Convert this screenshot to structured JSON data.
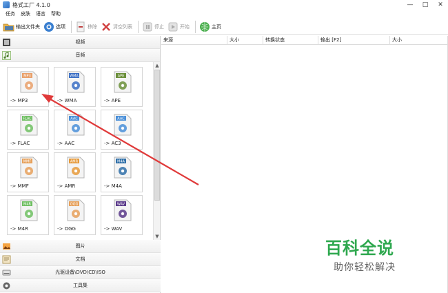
{
  "window": {
    "title": "格式工厂 4.1.0",
    "controls": [
      "—",
      "□",
      "✕"
    ]
  },
  "menu": [
    "任务",
    "皮肤",
    "语言",
    "帮助"
  ],
  "toolbar": {
    "output_folder": "输出文件夹",
    "options": "选项",
    "remove": "移除",
    "clear_list": "清空列表",
    "stop": "停止",
    "start": "开始",
    "home": "主页"
  },
  "categories": {
    "video": "视频",
    "audio": "音频",
    "picture": "图片",
    "document": "文档",
    "disc": "光驱设备\\DVD\\CD\\ISO",
    "tools": "工具集"
  },
  "audio_formats": [
    {
      "badge": "MP3",
      "label": "-> MP3",
      "color": "#e9a06a"
    },
    {
      "badge": "WMA",
      "label": "-> WMA",
      "color": "#3a6ec4"
    },
    {
      "badge": "APE",
      "label": "-> APE",
      "color": "#6b8f3a"
    },
    {
      "badge": "FLAC",
      "label": "-> FLAC",
      "color": "#6fbf62"
    },
    {
      "badge": "AAC",
      "label": "-> AAC",
      "color": "#4a8fd8"
    },
    {
      "badge": "AAC",
      "label": "-> AC3",
      "color": "#4a8fd8"
    },
    {
      "badge": "MMF",
      "label": "-> MMF",
      "color": "#e6a05a"
    },
    {
      "badge": "AMR",
      "label": "-> AMR",
      "color": "#e69a3a"
    },
    {
      "badge": "M4A",
      "label": "-> M4A",
      "color": "#2f6fa8"
    },
    {
      "badge": "M4R",
      "label": "-> M4R",
      "color": "#6fbf62"
    },
    {
      "badge": "OGG",
      "label": "-> OGG",
      "color": "#e6a05a"
    },
    {
      "badge": "WAV",
      "label": "-> WAV",
      "color": "#5a3a8a"
    }
  ],
  "list_columns": [
    "来源",
    "大小",
    "转换状态",
    "输出 [F2]",
    "大小"
  ],
  "watermark": {
    "title": "百科全说",
    "subtitle": "助你轻松解决"
  },
  "colors": {
    "arrow": "#e03a3a",
    "watermark_green": "#2fa84f"
  }
}
